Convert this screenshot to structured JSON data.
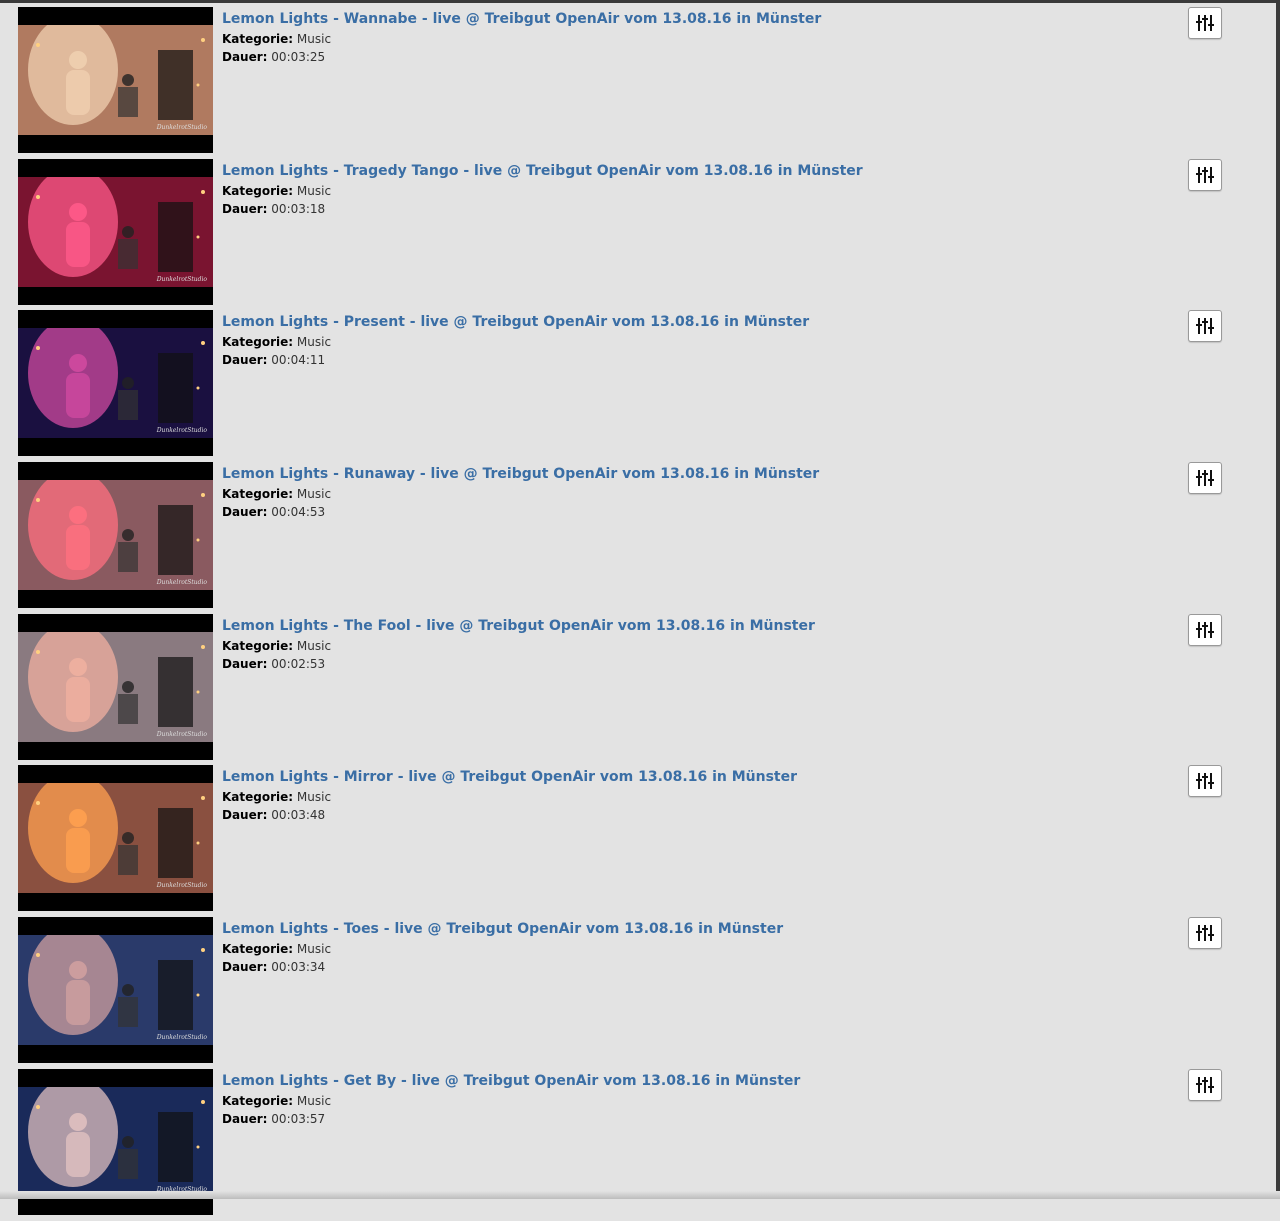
{
  "labels": {
    "category": "Kategorie:",
    "duration": "Dauer:"
  },
  "videos": [
    {
      "title": "Lemon Lights - Wannabe - live @ Treibgut OpenAir vom 13.08.16 in Münster",
      "category": "Music",
      "duration": "00:03:25",
      "tint": "#b07a60",
      "glow": "#f0d0b0"
    },
    {
      "title": "Lemon Lights - Tragedy Tango - live @ Treibgut OpenAir vom 13.08.16 in Münster",
      "category": "Music",
      "duration": "00:03:18",
      "tint": "#7a1430",
      "glow": "#ff5a8a"
    },
    {
      "title": "Lemon Lights - Present - live @ Treibgut OpenAir vom 13.08.16 in Münster",
      "category": "Music",
      "duration": "00:04:11",
      "tint": "#1a1040",
      "glow": "#d04aa0"
    },
    {
      "title": "Lemon Lights - Runaway - live @ Treibgut OpenAir vom 13.08.16 in Münster",
      "category": "Music",
      "duration": "00:04:53",
      "tint": "#8a5a60",
      "glow": "#ff7080"
    },
    {
      "title": "Lemon Lights - The Fool - live @ Treibgut OpenAir vom 13.08.16 in Münster",
      "category": "Music",
      "duration": "00:02:53",
      "tint": "#8a7a80",
      "glow": "#f0b0a0"
    },
    {
      "title": "Lemon Lights - Mirror - live @ Treibgut OpenAir vom 13.08.16 in Münster",
      "category": "Music",
      "duration": "00:03:48",
      "tint": "#8a5040",
      "glow": "#ffa050"
    },
    {
      "title": "Lemon Lights - Toes - live @ Treibgut OpenAir vom 13.08.16 in Münster",
      "category": "Music",
      "duration": "00:03:34",
      "tint": "#2a3a6a",
      "glow": "#d0a0a0"
    },
    {
      "title": "Lemon Lights - Get By - live @ Treibgut OpenAir vom 13.08.16 in Münster",
      "category": "Music",
      "duration": "00:03:57",
      "tint": "#1a2a5a",
      "glow": "#e0c0c0"
    }
  ],
  "icons": {
    "options": "sliders-icon"
  },
  "colors": {
    "link": "#3a6ea5",
    "background": "#e3e3e3"
  }
}
